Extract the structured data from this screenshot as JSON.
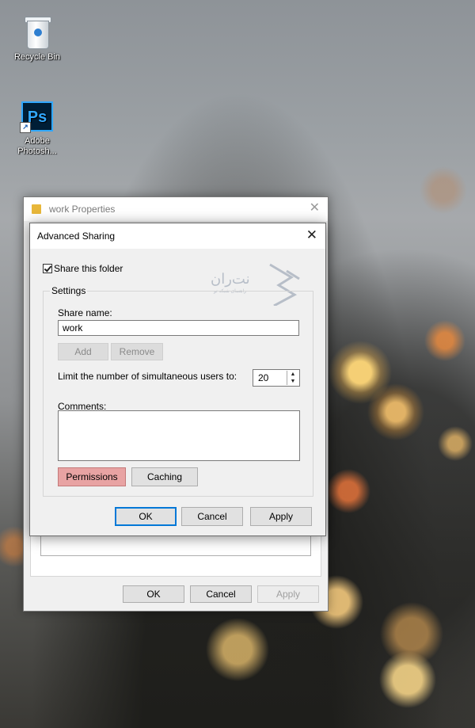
{
  "desktop": {
    "icons": [
      {
        "label": "Recycle Bin",
        "icon": "recycle-bin-icon"
      },
      {
        "label": "Adobe Photosh...",
        "icon": "photoshop-icon",
        "glyph": "Ps"
      }
    ]
  },
  "properties_window": {
    "title": "work Properties",
    "close_glyph": "✕",
    "buttons": {
      "ok": "OK",
      "cancel": "Cancel",
      "apply": "Apply"
    }
  },
  "advanced_sharing": {
    "title": "Advanced Sharing",
    "close_glyph": "✕",
    "share_checkbox_label": "Share this folder",
    "share_checked": true,
    "settings_label": "Settings",
    "share_name_label": "Share name:",
    "share_name_value": "work",
    "add_label": "Add",
    "remove_label": "Remove",
    "limit_label": "Limit the number of simultaneous users to:",
    "limit_value": "20",
    "comments_label": "Comments:",
    "comments_value": "",
    "permissions_label": "Permissions",
    "caching_label": "Caching",
    "buttons": {
      "ok": "OK",
      "cancel": "Cancel",
      "apply": "Apply"
    }
  },
  "watermark": {
    "text": "نت‌ران",
    "subtext": "راهنمای شبکه تو"
  },
  "colors": {
    "permissions_highlight": "#e8a3a3",
    "ok_focus_border": "#0078d7"
  }
}
